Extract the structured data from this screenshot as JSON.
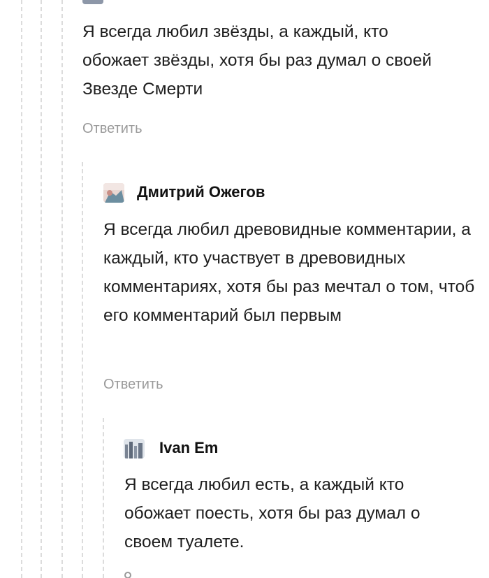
{
  "comments": [
    {
      "text": "Я всегда любил звёзды, а каждый, кто обожает звёзды, хотя бы раз думал о своей Звезде Смерти",
      "reply_label": "Ответить"
    },
    {
      "author": "Дмитрий Ожегов",
      "text": "Я всегда любил древовидные комментарии, а каждый, кто участвует в древовидных комментариях, хотя бы раз мечтал о том, чтоб его комментарий был первым",
      "reply_label": "Ответить"
    },
    {
      "author": "Ivan Em",
      "text": "Я всегда любил есть, а каждый кто обожает поесть, хотя бы раз думал о своем туалете."
    }
  ]
}
